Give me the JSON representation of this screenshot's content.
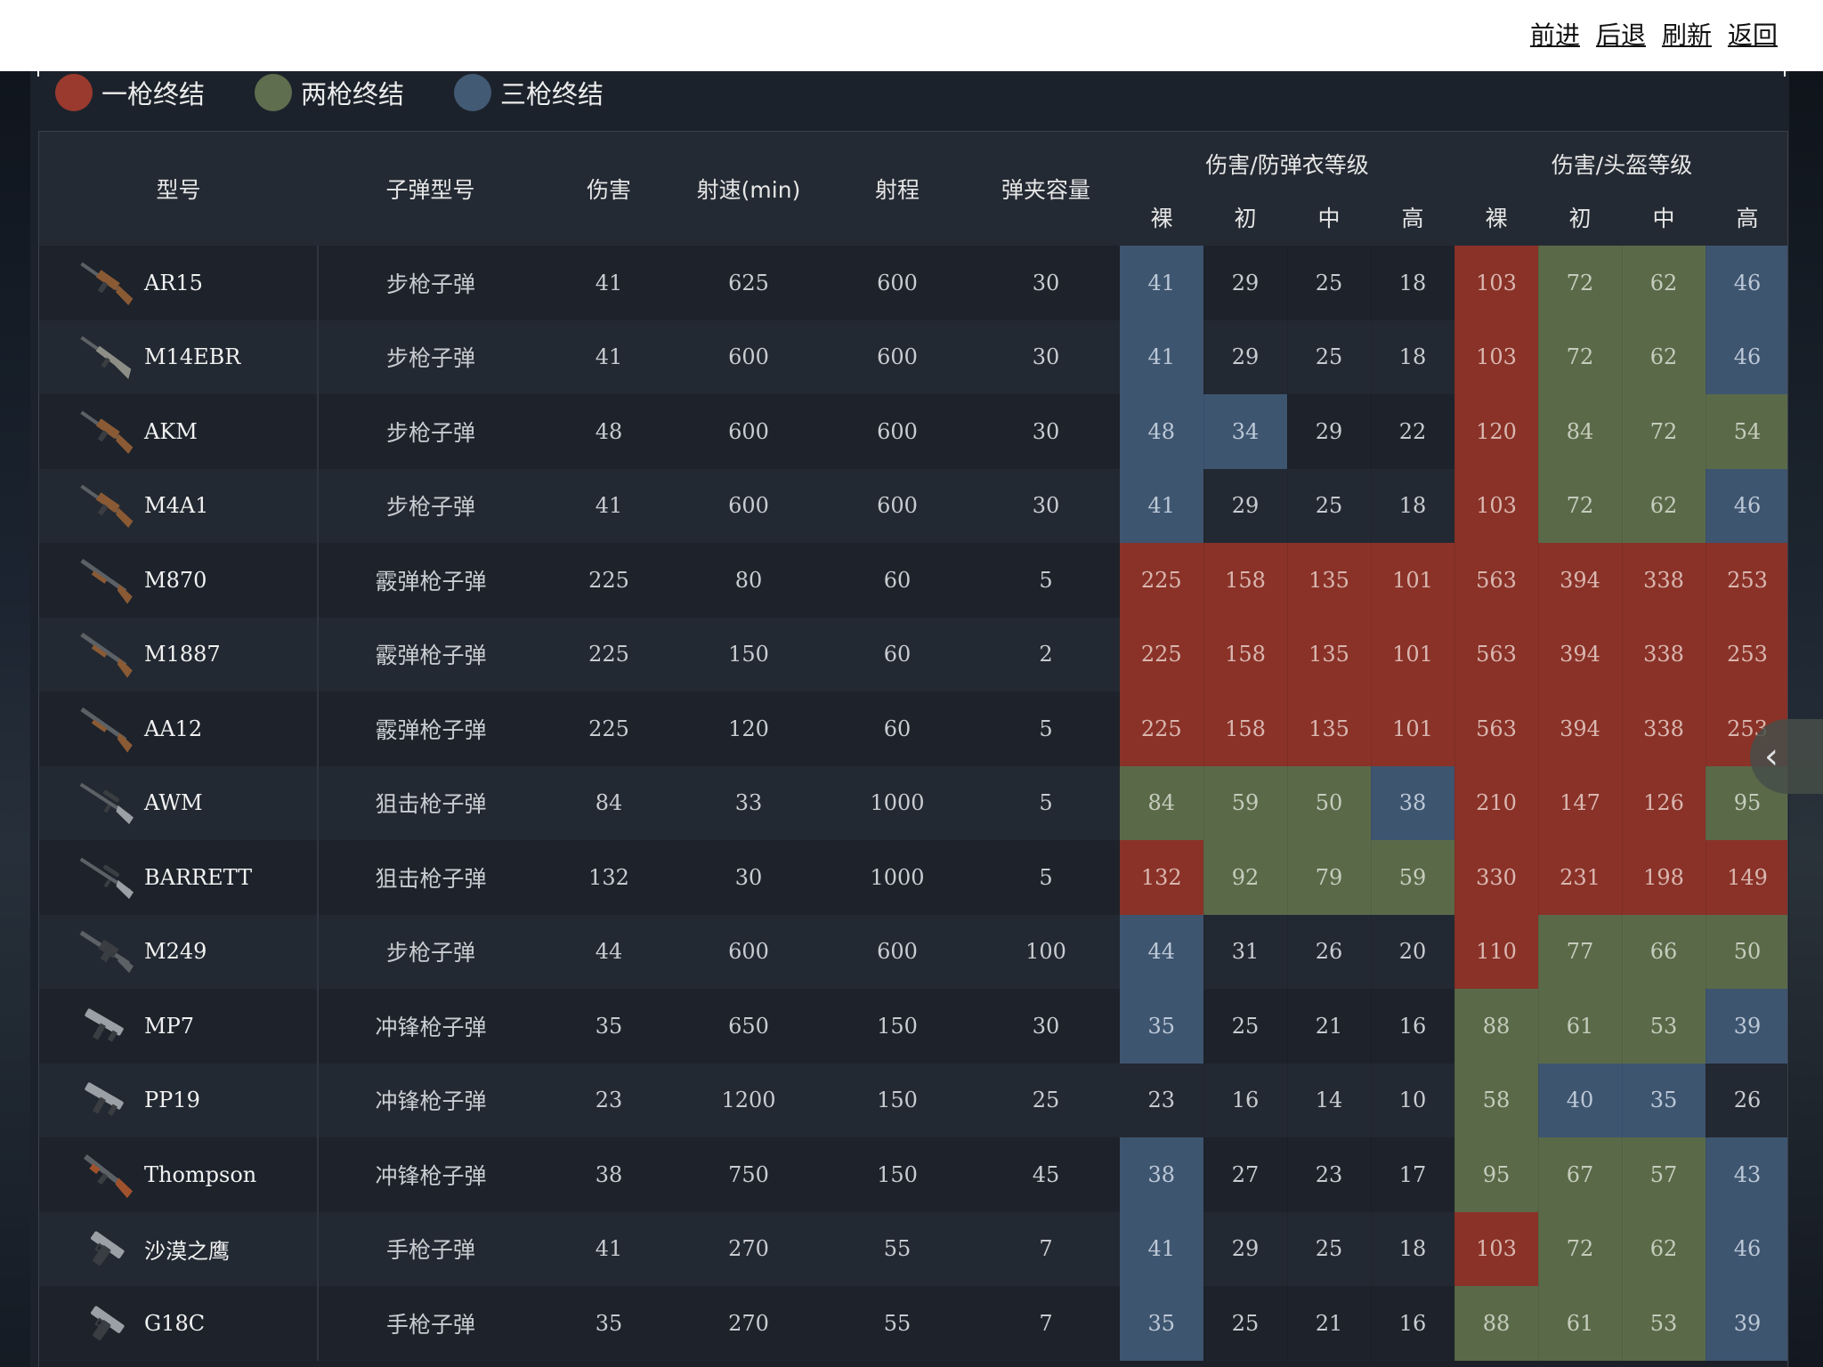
{
  "nav": {
    "forward": "前进",
    "back": "后退",
    "refresh": "刷新",
    "return": "返回"
  },
  "legend": [
    {
      "label": "一枪终结",
      "color": "#9a3a2e"
    },
    {
      "label": "两枪终结",
      "color": "#5f6e4e"
    },
    {
      "label": "三枪终结",
      "color": "#435a74"
    }
  ],
  "headers": {
    "model": "型号",
    "ammo": "子弹型号",
    "damage": "伤害",
    "rate": "射速(min)",
    "range": "射程",
    "mag": "弹夹容量",
    "armor_group": "伤害/防弹衣等级",
    "helmet_group": "伤害/头盔等级",
    "levels": [
      "裸",
      "初",
      "中",
      "高"
    ]
  },
  "rows": [
    {
      "model": "AR15",
      "ammo": "步枪子弹",
      "damage": "41",
      "rate": "625",
      "range": "600",
      "mag": "30",
      "armor": [
        "41",
        "29",
        "25",
        "18"
      ],
      "armor_c": [
        "b",
        "",
        "",
        ""
      ],
      "helmet": [
        "103",
        "72",
        "62",
        "46"
      ],
      "helmet_c": [
        "r",
        "g",
        "g",
        "b"
      ],
      "icon": "assault-rifle"
    },
    {
      "model": "M14EBR",
      "ammo": "步枪子弹",
      "damage": "41",
      "rate": "600",
      "range": "600",
      "mag": "30",
      "armor": [
        "41",
        "29",
        "25",
        "18"
      ],
      "armor_c": [
        "b",
        "",
        "",
        ""
      ],
      "helmet": [
        "103",
        "72",
        "62",
        "46"
      ],
      "helmet_c": [
        "r",
        "g",
        "g",
        "b"
      ],
      "icon": "rifle"
    },
    {
      "model": "AKM",
      "ammo": "步枪子弹",
      "damage": "48",
      "rate": "600",
      "range": "600",
      "mag": "30",
      "armor": [
        "48",
        "34",
        "29",
        "22"
      ],
      "armor_c": [
        "b",
        "b",
        "",
        ""
      ],
      "helmet": [
        "120",
        "84",
        "72",
        "54"
      ],
      "helmet_c": [
        "r",
        "g",
        "g",
        "g"
      ],
      "icon": "assault-rifle"
    },
    {
      "model": "M4A1",
      "ammo": "步枪子弹",
      "damage": "41",
      "rate": "600",
      "range": "600",
      "mag": "30",
      "armor": [
        "41",
        "29",
        "25",
        "18"
      ],
      "armor_c": [
        "b",
        "",
        "",
        ""
      ],
      "helmet": [
        "103",
        "72",
        "62",
        "46"
      ],
      "helmet_c": [
        "r",
        "g",
        "g",
        "b"
      ],
      "icon": "assault-rifle"
    },
    {
      "model": "M870",
      "ammo": "霰弹枪子弹",
      "damage": "225",
      "rate": "80",
      "range": "60",
      "mag": "5",
      "armor": [
        "225",
        "158",
        "135",
        "101"
      ],
      "armor_c": [
        "r",
        "r",
        "r",
        "r"
      ],
      "helmet": [
        "563",
        "394",
        "338",
        "253"
      ],
      "helmet_c": [
        "r",
        "r",
        "r",
        "r"
      ],
      "icon": "shotgun"
    },
    {
      "model": "M1887",
      "ammo": "霰弹枪子弹",
      "damage": "225",
      "rate": "150",
      "range": "60",
      "mag": "2",
      "armor": [
        "225",
        "158",
        "135",
        "101"
      ],
      "armor_c": [
        "r",
        "r",
        "r",
        "r"
      ],
      "helmet": [
        "563",
        "394",
        "338",
        "253"
      ],
      "helmet_c": [
        "r",
        "r",
        "r",
        "r"
      ],
      "icon": "shotgun"
    },
    {
      "model": "AA12",
      "ammo": "霰弹枪子弹",
      "damage": "225",
      "rate": "120",
      "range": "60",
      "mag": "5",
      "armor": [
        "225",
        "158",
        "135",
        "101"
      ],
      "armor_c": [
        "r",
        "r",
        "r",
        "r"
      ],
      "helmet": [
        "563",
        "394",
        "338",
        "253"
      ],
      "helmet_c": [
        "r",
        "r",
        "r",
        "r"
      ],
      "icon": "shotgun"
    },
    {
      "model": "AWM",
      "ammo": "狙击枪子弹",
      "damage": "84",
      "rate": "33",
      "range": "1000",
      "mag": "5",
      "armor": [
        "84",
        "59",
        "50",
        "38"
      ],
      "armor_c": [
        "g",
        "g",
        "g",
        "b"
      ],
      "helmet": [
        "210",
        "147",
        "126",
        "95"
      ],
      "helmet_c": [
        "r",
        "r",
        "r",
        "g"
      ],
      "icon": "sniper-rifle"
    },
    {
      "model": "BARRETT",
      "ammo": "狙击枪子弹",
      "damage": "132",
      "rate": "30",
      "range": "1000",
      "mag": "5",
      "armor": [
        "132",
        "92",
        "79",
        "59"
      ],
      "armor_c": [
        "r",
        "g",
        "g",
        "g"
      ],
      "helmet": [
        "330",
        "231",
        "198",
        "149"
      ],
      "helmet_c": [
        "r",
        "r",
        "r",
        "r"
      ],
      "icon": "sniper-rifle"
    },
    {
      "model": "M249",
      "ammo": "步枪子弹",
      "damage": "44",
      "rate": "600",
      "range": "600",
      "mag": "100",
      "armor": [
        "44",
        "31",
        "26",
        "20"
      ],
      "armor_c": [
        "b",
        "",
        "",
        ""
      ],
      "helmet": [
        "110",
        "77",
        "66",
        "50"
      ],
      "helmet_c": [
        "r",
        "g",
        "g",
        "g"
      ],
      "icon": "machine-gun"
    },
    {
      "model": "MP7",
      "ammo": "冲锋枪子弹",
      "damage": "35",
      "rate": "650",
      "range": "150",
      "mag": "30",
      "armor": [
        "35",
        "25",
        "21",
        "16"
      ],
      "armor_c": [
        "b",
        "",
        "",
        ""
      ],
      "helmet": [
        "88",
        "61",
        "53",
        "39"
      ],
      "helmet_c": [
        "g",
        "g",
        "g",
        "b"
      ],
      "icon": "smg"
    },
    {
      "model": "PP19",
      "ammo": "冲锋枪子弹",
      "damage": "23",
      "rate": "1200",
      "range": "150",
      "mag": "25",
      "armor": [
        "23",
        "16",
        "14",
        "10"
      ],
      "armor_c": [
        "",
        "",
        "",
        ""
      ],
      "helmet": [
        "58",
        "40",
        "35",
        "26"
      ],
      "helmet_c": [
        "g",
        "b",
        "b",
        ""
      ],
      "icon": "smg"
    },
    {
      "model": "Thompson",
      "ammo": "冲锋枪子弹",
      "damage": "38",
      "rate": "750",
      "range": "150",
      "mag": "45",
      "armor": [
        "38",
        "27",
        "23",
        "17"
      ],
      "armor_c": [
        "b",
        "",
        "",
        ""
      ],
      "helmet": [
        "95",
        "67",
        "57",
        "43"
      ],
      "helmet_c": [
        "g",
        "g",
        "g",
        "b"
      ],
      "icon": "tommy-gun"
    },
    {
      "model": "沙漠之鹰",
      "ammo": "手枪子弹",
      "damage": "41",
      "rate": "270",
      "range": "55",
      "mag": "7",
      "armor": [
        "41",
        "29",
        "25",
        "18"
      ],
      "armor_c": [
        "b",
        "",
        "",
        ""
      ],
      "helmet": [
        "103",
        "72",
        "62",
        "46"
      ],
      "helmet_c": [
        "r",
        "g",
        "g",
        "b"
      ],
      "icon": "pistol"
    },
    {
      "model": "G18C",
      "ammo": "手枪子弹",
      "damage": "35",
      "rate": "270",
      "range": "55",
      "mag": "7",
      "armor": [
        "35",
        "25",
        "21",
        "16"
      ],
      "armor_c": [
        "b",
        "",
        "",
        ""
      ],
      "helmet": [
        "88",
        "61",
        "53",
        "39"
      ],
      "helmet_c": [
        "g",
        "g",
        "g",
        "b"
      ],
      "icon": "pistol"
    }
  ]
}
